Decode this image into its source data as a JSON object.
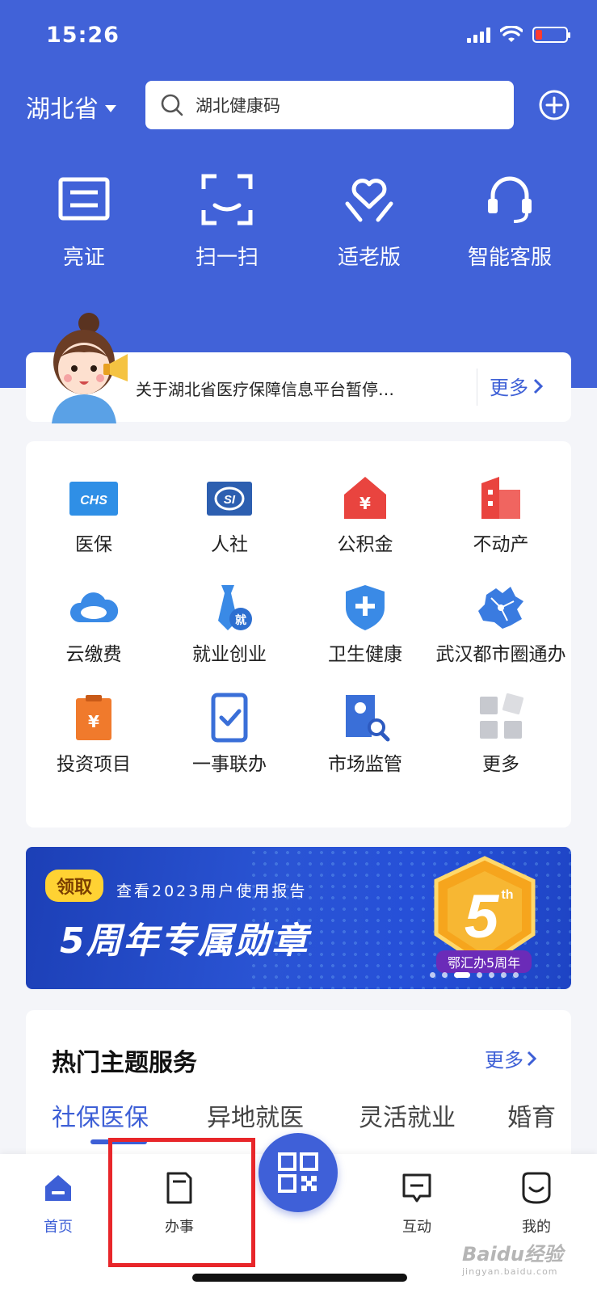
{
  "status_bar": {
    "time": "15:26"
  },
  "header": {
    "province": "湖北省",
    "search_value": "湖北健康码"
  },
  "quick_actions": [
    {
      "label": "亮证",
      "icon": "id-card-icon"
    },
    {
      "label": "扫一扫",
      "icon": "scan-icon"
    },
    {
      "label": "适老版",
      "icon": "elder-care-icon"
    },
    {
      "label": "智能客服",
      "icon": "headset-icon"
    }
  ],
  "notice": {
    "text": "关于湖北省医疗保障信息平台暂停…",
    "more_label": "更多"
  },
  "services": [
    {
      "label": "医保",
      "icon": "chs-icon",
      "color": "#2f8fe6"
    },
    {
      "label": "人社",
      "icon": "si-icon",
      "color": "#2d5fb0"
    },
    {
      "label": "公积金",
      "icon": "house-fund-icon",
      "color": "#e9443f"
    },
    {
      "label": "不动产",
      "icon": "building-icon",
      "color": "#e9443f"
    },
    {
      "label": "云缴费",
      "icon": "cloud-icon",
      "color": "#3a8ae6"
    },
    {
      "label": "就业创业",
      "icon": "tie-icon",
      "color": "#3a8ae6"
    },
    {
      "label": "卫生健康",
      "icon": "health-shield-icon",
      "color": "#3a8ae6"
    },
    {
      "label": "武汉都市圈通办",
      "icon": "map-icon",
      "color": "#3a7be0"
    },
    {
      "label": "投资项目",
      "icon": "clipboard-yen-icon",
      "color": "#f07a2c"
    },
    {
      "label": "一事联办",
      "icon": "phone-check-icon",
      "color": "#3a6fd8"
    },
    {
      "label": "市场监管",
      "icon": "market-supervision-icon",
      "color": "#3a6fd8"
    },
    {
      "label": "更多",
      "icon": "more-grid-icon",
      "color": "#c7c9cf"
    }
  ],
  "banner": {
    "claim_label": "领取",
    "subtitle": "查看2023用户使用报告",
    "title": "5周年专属勋章",
    "medal_number": "5",
    "medal_suffix": "th",
    "medal_caption": "鄂汇办5周年"
  },
  "hot_topics": {
    "title": "热门主题服务",
    "more_label": "更多",
    "tabs": [
      "社保医保",
      "异地就医",
      "灵活就业",
      "婚育"
    ]
  },
  "bottom_nav": [
    {
      "label": "首页",
      "active": true
    },
    {
      "label": "办事",
      "active": false
    },
    {
      "label": "互动",
      "active": false
    },
    {
      "label": "我的",
      "active": false
    }
  ],
  "watermark": {
    "brand": "Baidu经验",
    "url": "jingyan.baidu.com"
  },
  "colors": {
    "brand_blue": "#4162d8",
    "link_blue": "#3d5fd6",
    "highlight_red": "#e8262a"
  }
}
